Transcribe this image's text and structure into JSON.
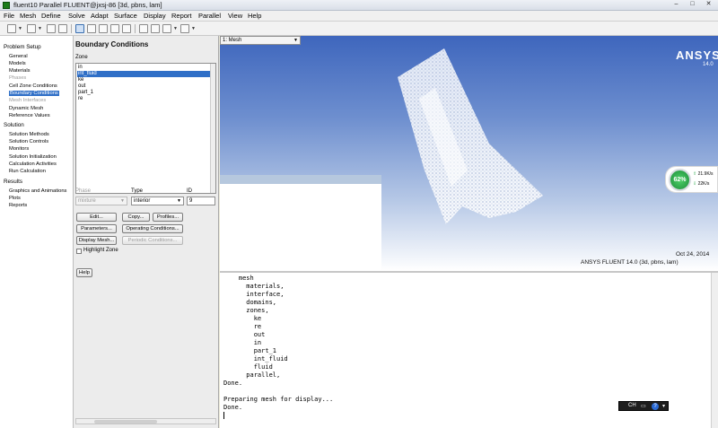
{
  "window": {
    "title": "fluent10 Parallel FLUENT@jxsj-86  [3d, pbns, lam]",
    "minimize_glyph": "–",
    "maximize_glyph": "□",
    "close_glyph": "✕"
  },
  "menu": [
    "File",
    "Mesh",
    "Define",
    "Solve",
    "Adapt",
    "Surface",
    "Display",
    "Report",
    "Parallel",
    "View",
    "Help"
  ],
  "toolbar": {
    "icons": [
      "open-icon",
      "save-icon",
      "print-icon",
      "camera-icon",
      "select-icon",
      "pan-icon",
      "zoom-in-icon",
      "zoom-out-icon",
      "rotate-icon",
      "zoom-fit-icon",
      "probe-icon",
      "ruler-icon",
      "window-icon"
    ]
  },
  "nav": {
    "problem_setup": {
      "heading": "Problem Setup",
      "items": [
        {
          "label": "General",
          "state": "normal"
        },
        {
          "label": "Models",
          "state": "normal"
        },
        {
          "label": "Materials",
          "state": "normal"
        },
        {
          "label": "Phases",
          "state": "disabled"
        },
        {
          "label": "Cell Zone Conditions",
          "state": "normal"
        },
        {
          "label": "Boundary Conditions",
          "state": "selected"
        },
        {
          "label": "Mesh Interfaces",
          "state": "disabled"
        },
        {
          "label": "Dynamic Mesh",
          "state": "normal"
        },
        {
          "label": "Reference Values",
          "state": "normal"
        }
      ]
    },
    "solution": {
      "heading": "Solution",
      "items": [
        {
          "label": "Solution Methods"
        },
        {
          "label": "Solution Controls"
        },
        {
          "label": "Monitors"
        },
        {
          "label": "Solution Initialization"
        },
        {
          "label": "Calculation Activities"
        },
        {
          "label": "Run Calculation"
        }
      ]
    },
    "results": {
      "heading": "Results",
      "items": [
        {
          "label": "Graphics and Animations"
        },
        {
          "label": "Plots"
        },
        {
          "label": "Reports"
        }
      ]
    }
  },
  "task": {
    "title": "Boundary Conditions",
    "zone_label": "Zone",
    "zones": [
      "in",
      "int_fluid",
      "ke",
      "out",
      "part_1",
      "re"
    ],
    "selected_zone": "int_fluid",
    "phase_label": "Phase",
    "phase_value": "mixture",
    "type_label": "Type",
    "type_value": "interior",
    "id_label": "ID",
    "id_value": "9",
    "buttons": {
      "edit": "Edit...",
      "copy": "Copy...",
      "profiles": "Profiles...",
      "parameters": "Parameters...",
      "operating": "Operating Conditions...",
      "display_mesh": "Display Mesh...",
      "periodic": "Periodic Conditions..."
    },
    "highlight_zone": "Highlight Zone",
    "help": "Help"
  },
  "graphics": {
    "window_select": "1: Mesh",
    "logo": "ANSYS",
    "version": "14.0",
    "date": "Oct 24, 2014",
    "footer": "ANSYS FLUENT 14.0 (3d, pbns, lam)"
  },
  "network_widget": {
    "percent": "62%",
    "up": "21.9K/s",
    "down": "22K/s",
    "percent_level": 0.62
  },
  "console": {
    "text": "    mesh\n      materials,\n      interface,\n      domains,\n      zones,\n        ke\n        re\n        out\n        in\n        part_1\n        int_fluid\n        fluid\n      parallel,\nDone.\n\nPreparing mesh for display...\nDone."
  },
  "ime_bar": {
    "label": "CH"
  },
  "colors": {
    "selection": "#2f6fc7",
    "gradient_top": "#3e66bd",
    "gradient_bottom": "#ffffff",
    "gauge": "#2aa84a"
  }
}
